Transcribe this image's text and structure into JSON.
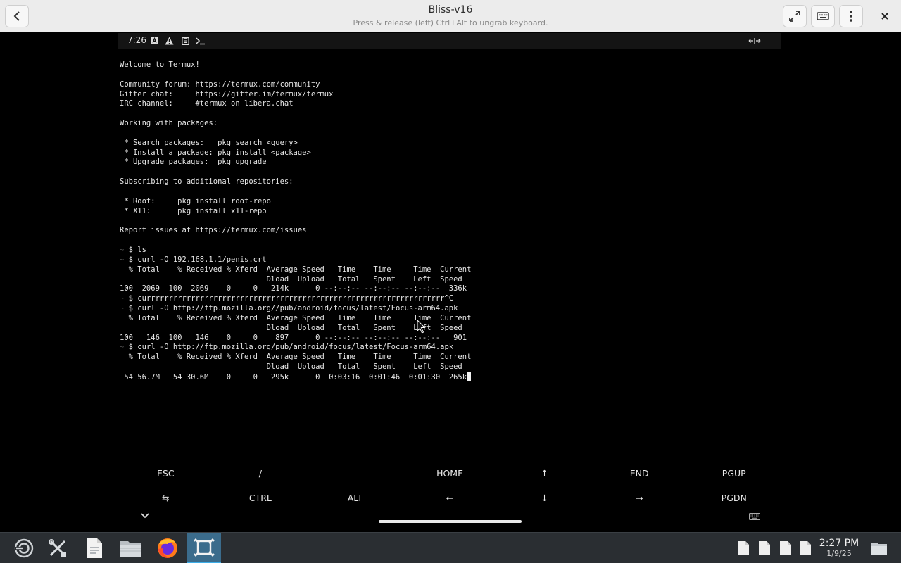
{
  "window": {
    "title": "Bliss-v16",
    "subtitle": "Press & release (left) Ctrl+Alt to ungrab keyboard."
  },
  "statusbar": {
    "time": "7:26",
    "icons": [
      "notification-a-icon",
      "warning-icon",
      "clipboard-icon",
      "terminal-icon"
    ],
    "right_icon": "keyboard-swap-icon"
  },
  "terminal": {
    "prompt_symbol": "~",
    "lines": [
      {
        "p": "",
        "t": "Welcome to Termux!"
      },
      {
        "p": "",
        "t": ""
      },
      {
        "p": "",
        "t": "Community forum: https://termux.com/community"
      },
      {
        "p": "",
        "t": "Gitter chat:     https://gitter.im/termux/termux"
      },
      {
        "p": "",
        "t": "IRC channel:     #termux on libera.chat"
      },
      {
        "p": "",
        "t": ""
      },
      {
        "p": "",
        "t": "Working with packages:"
      },
      {
        "p": "",
        "t": ""
      },
      {
        "p": "",
        "t": " * Search packages:   pkg search <query>"
      },
      {
        "p": "",
        "t": " * Install a package: pkg install <package>"
      },
      {
        "p": "",
        "t": " * Upgrade packages:  pkg upgrade"
      },
      {
        "p": "",
        "t": ""
      },
      {
        "p": "",
        "t": "Subscribing to additional repositories:"
      },
      {
        "p": "",
        "t": ""
      },
      {
        "p": "",
        "t": " * Root:     pkg install root-repo"
      },
      {
        "p": "",
        "t": " * X11:      pkg install x11-repo"
      },
      {
        "p": "",
        "t": ""
      },
      {
        "p": "",
        "t": "Report issues at https://termux.com/issues"
      },
      {
        "p": "",
        "t": ""
      },
      {
        "p": "~",
        "t": " $ ls"
      },
      {
        "p": "~",
        "t": " $ curl -O 192.168.1.1/penis.crt"
      },
      {
        "p": "",
        "t": "  % Total    % Received % Xferd  Average Speed   Time    Time     Time  Current"
      },
      {
        "p": "",
        "t": "                                 Dload  Upload   Total   Spent    Left  Speed"
      },
      {
        "p": "",
        "t": "100  2069  100  2069    0     0   214k      0 --:--:-- --:--:-- --:--:--  336k"
      },
      {
        "p": "~",
        "t": " $ currrrrrrrrrrrrrrrrrrrrrrrrrrrrrrrrrrrrrrrrrrrrrrrrrrrrrrrrrrrrrrrrrr^C"
      },
      {
        "p": "~",
        "t": " $ curl -O http://ftp.mozilla.org//pub/android/focus/latest/Focus-arm64.apk"
      },
      {
        "p": "",
        "t": "  % Total    % Received % Xferd  Average Speed   Time    Time     Time  Current"
      },
      {
        "p": "",
        "t": "                                 Dload  Upload   Total   Spent    Left  Speed"
      },
      {
        "p": "",
        "t": "100   146  100   146    0     0    897      0 --:--:-- --:--:-- --:--:--   901"
      },
      {
        "p": "~",
        "t": " $ curl -O http://ftp.mozilla.org/pub/android/focus/latest/Focus-arm64.apk"
      },
      {
        "p": "",
        "t": "  % Total    % Received % Xferd  Average Speed   Time    Time     Time  Current"
      },
      {
        "p": "",
        "t": "                                 Dload  Upload   Total   Spent    Left  Speed"
      },
      {
        "p": "",
        "t": " 54 56.7M   54 30.6M    0     0   295k      0  0:03:16  0:01:46  0:01:30  265k"
      }
    ]
  },
  "extra_keys": {
    "row1": [
      "ESC",
      "/",
      "—",
      "HOME",
      "↑",
      "END",
      "PGUP"
    ],
    "row2": [
      "⇆",
      "CTRL",
      "ALT",
      "←",
      "↓",
      "→",
      "PGDN"
    ]
  },
  "taskbar": {
    "apps": [
      "app-launcher-icon",
      "system-settings-icon",
      "text-editor-icon",
      "file-manager-icon",
      "firefox-icon",
      "virt-manager-icon"
    ],
    "active_app": "virt-manager-icon",
    "clock_time": "2:27 PM",
    "clock_date": "1/9/25",
    "accent_color": "#3daee9"
  }
}
